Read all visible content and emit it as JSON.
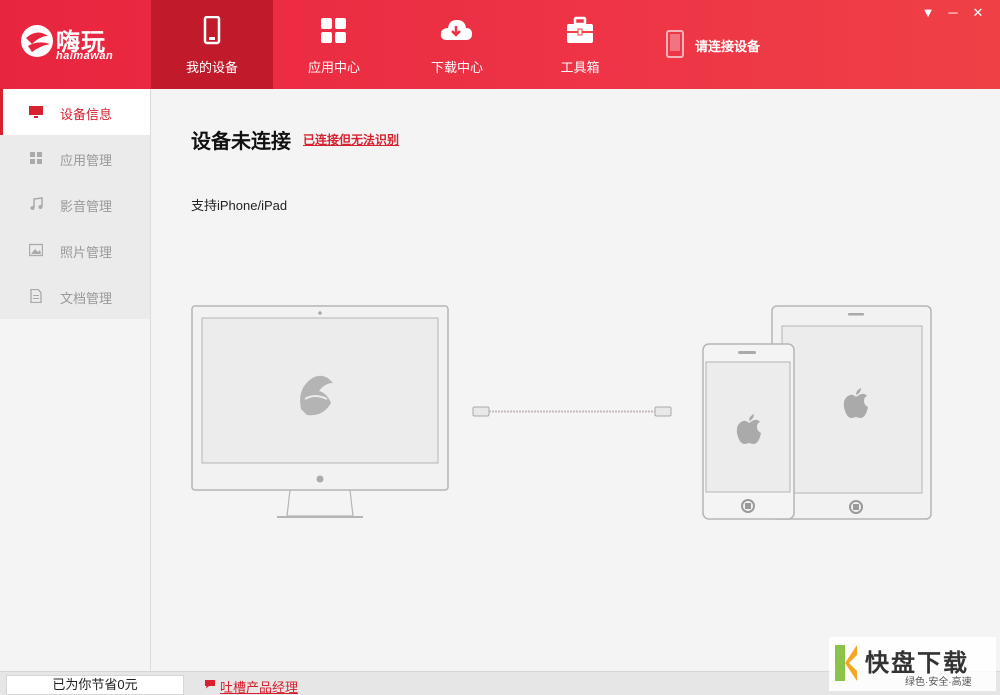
{
  "header": {
    "logo_text": "嗨玩",
    "logo_sub": "haimawan",
    "tabs": [
      {
        "label": "我的设备",
        "icon": "phone-icon",
        "active": true
      },
      {
        "label": "应用中心",
        "icon": "apps-grid-icon",
        "active": false
      },
      {
        "label": "下载中心",
        "icon": "cloud-download-icon",
        "active": false
      },
      {
        "label": "工具箱",
        "icon": "toolbox-icon",
        "active": false
      }
    ],
    "connect_status": "请连接设备",
    "window_controls": {
      "dropdown": "▼",
      "minimize": "─",
      "close": "✕"
    }
  },
  "sidebar": {
    "items": [
      {
        "label": "设备信息",
        "icon": "monitor-icon",
        "active": true
      },
      {
        "label": "应用管理",
        "icon": "apps-icon",
        "active": false
      },
      {
        "label": "影音管理",
        "icon": "music-note-icon",
        "active": false
      },
      {
        "label": "照片管理",
        "icon": "photo-icon",
        "active": false
      },
      {
        "label": "文档管理",
        "icon": "document-icon",
        "active": false
      }
    ]
  },
  "main": {
    "title": "设备未连接",
    "help_link": "已连接但无法识别",
    "support_text": "支持iPhone/iPad"
  },
  "footer": {
    "saved_text": "已为你节省0元",
    "feedback_link": "吐槽产品经理"
  },
  "watermark": {
    "text": "快盘下载",
    "sub": "绿色·安全·高速"
  },
  "colors": {
    "brand_red": "#e8253f",
    "active_tab": "#c11a2b",
    "link_red": "#d7212f"
  }
}
